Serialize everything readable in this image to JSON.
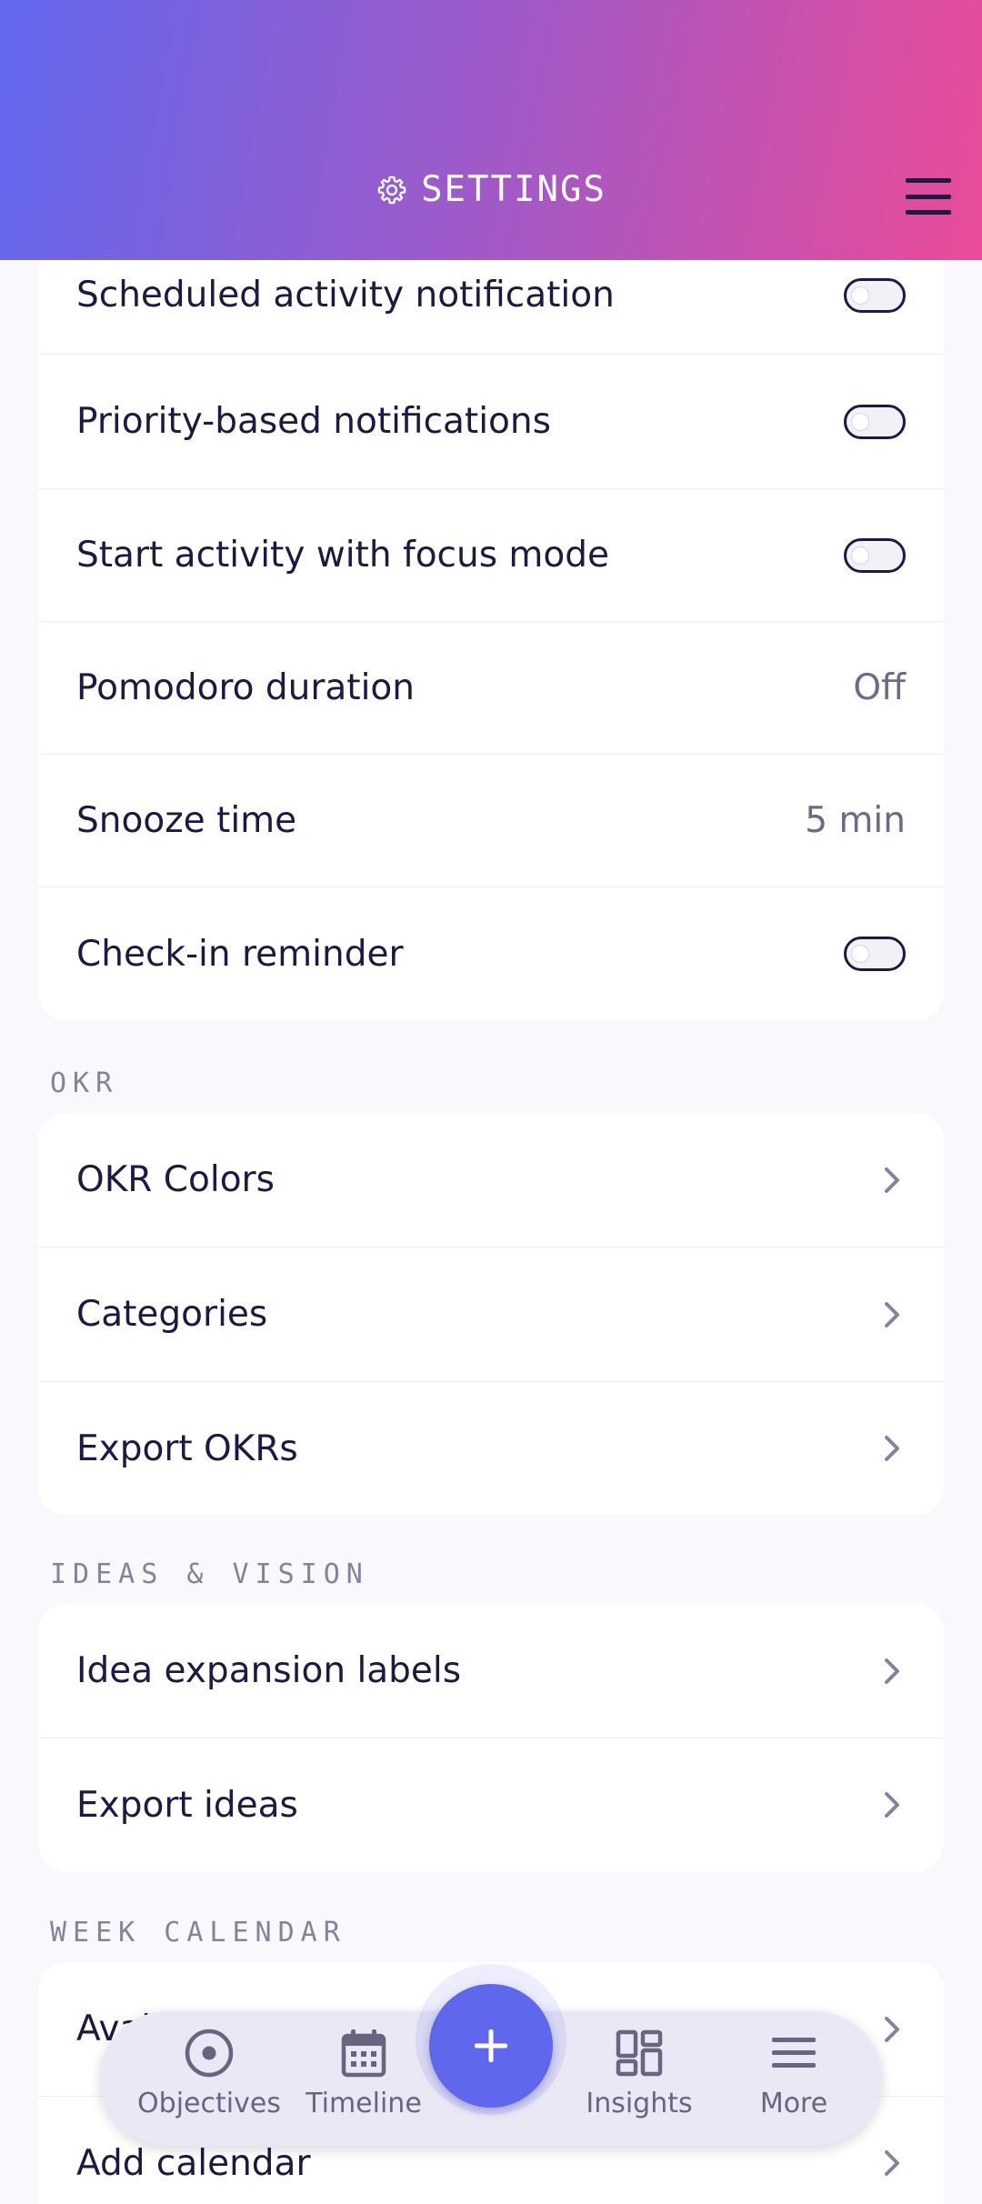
{
  "header": {
    "title": "SETTINGS",
    "icon": "gear-icon",
    "menu_icon": "hamburger-menu-icon"
  },
  "notifications_card": {
    "items": [
      {
        "label": "Scheduled activity notification",
        "control": "toggle",
        "enabled": false
      },
      {
        "label": "Priority-based notifications",
        "control": "toggle",
        "enabled": false
      },
      {
        "label": "Start activity with focus mode",
        "control": "toggle",
        "enabled": false
      },
      {
        "label": "Pomodoro duration",
        "control": "value",
        "value": "Off"
      },
      {
        "label": "Snooze time",
        "control": "value",
        "value": "5 min"
      },
      {
        "label": "Check-in reminder",
        "control": "toggle",
        "enabled": false
      }
    ]
  },
  "okr": {
    "title": "OKR",
    "items": [
      {
        "label": "OKR Colors"
      },
      {
        "label": "Categories"
      },
      {
        "label": "Export OKRs"
      }
    ]
  },
  "ideas": {
    "title": "IDEAS & VISION",
    "items": [
      {
        "label": "Idea expansion labels"
      },
      {
        "label": "Export ideas"
      }
    ]
  },
  "calendar": {
    "title": "WEEK CALENDAR",
    "items": [
      {
        "label": "Availability"
      },
      {
        "label": "Add calendar"
      }
    ]
  },
  "bottom_nav": {
    "items": [
      {
        "label": "Objectives",
        "icon": "target-icon"
      },
      {
        "label": "Timeline",
        "icon": "calendar-icon"
      },
      {
        "label": "Insights",
        "icon": "dashboard-icon"
      },
      {
        "label": "More",
        "icon": "menu-lines-icon"
      }
    ],
    "fab_icon": "plus-icon"
  },
  "colors": {
    "accent": "#5f67ec",
    "gradient_start": "#6268ee",
    "gradient_end": "#ea4b97",
    "text": "#1c1a45"
  }
}
